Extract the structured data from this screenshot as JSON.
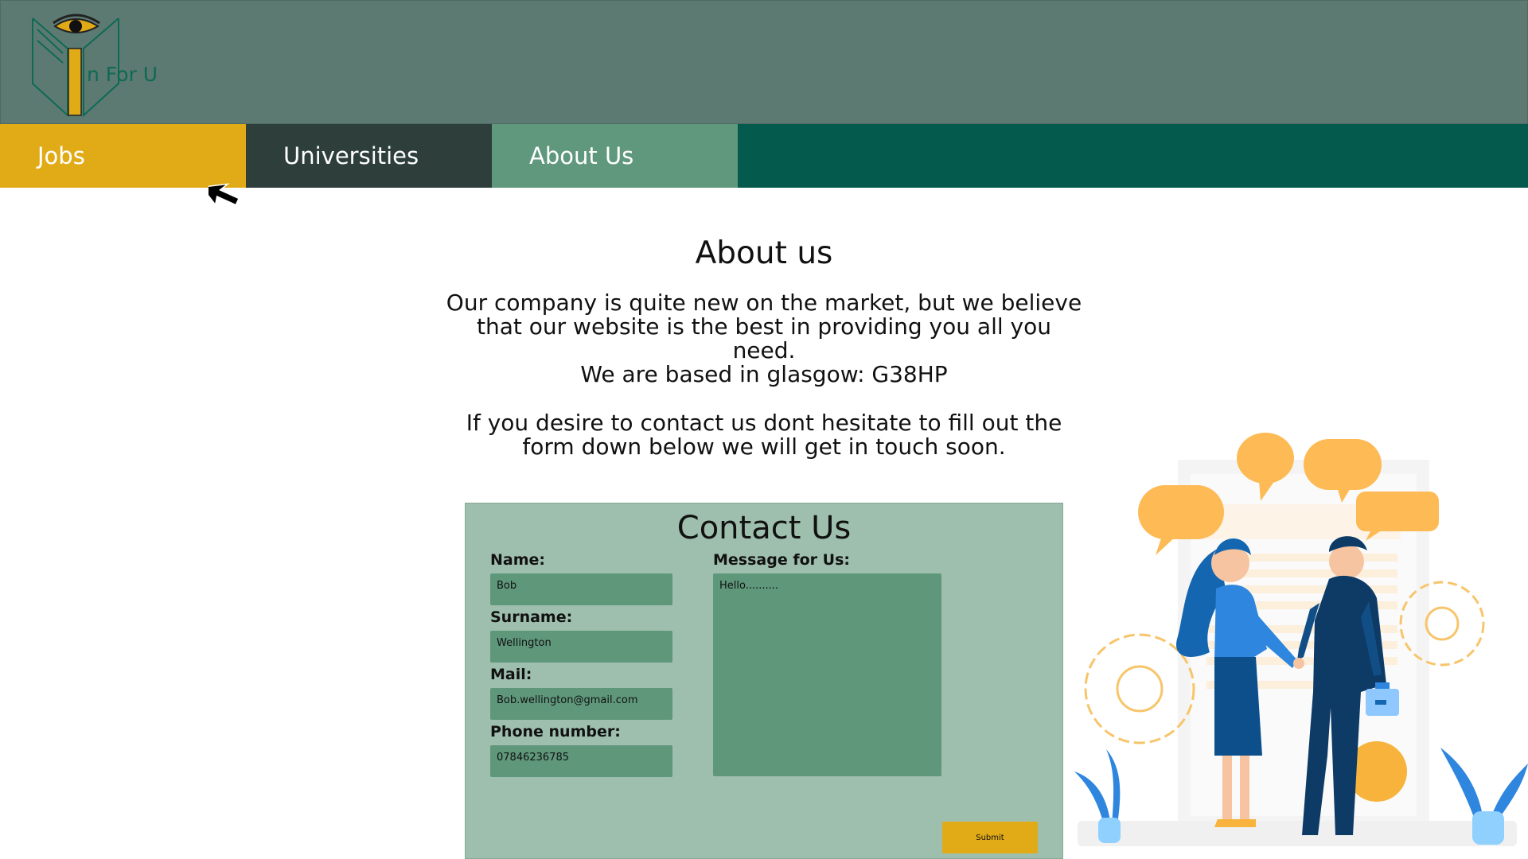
{
  "brand": {
    "logo_text": "n For U"
  },
  "nav": {
    "items": [
      {
        "label": "Jobs",
        "color": "#e1ab18"
      },
      {
        "label": "Universities",
        "color": "#2d3e3b"
      },
      {
        "label": "About Us",
        "color": "#5f987d"
      }
    ]
  },
  "about": {
    "title": "About us",
    "paragraph1": "Our company is quite new on the market, but we believe that our website is the best in providing you all you need.",
    "paragraph2": "We are based in glasgow: G38HP",
    "paragraph3": "If you desire to contact us dont hesitate to fill out the form down below we will get in touch soon."
  },
  "contact_form": {
    "title": "Contact Us",
    "name_label": "Name:",
    "name_value": "Bob",
    "surname_label": "Surname:",
    "surname_value": "Wellington",
    "mail_label": "Mail:",
    "mail_value": "Bob.wellington@gmail.com",
    "phone_label": "Phone number:",
    "phone_value": "07846236785",
    "message_label": "Message for Us:",
    "message_value": "Hello..........",
    "submit_label": "Submit"
  },
  "icons": {
    "logo": "eye-book-logo-icon",
    "cursor": "mouse-pointer-icon",
    "illustration": "handshake-business-illustration"
  },
  "colors": {
    "header_bg": "#5c7a72",
    "nav_bg": "#045a4d",
    "form_bg": "#9ebfad",
    "input_bg": "#5f977b",
    "accent": "#e1ab18"
  }
}
